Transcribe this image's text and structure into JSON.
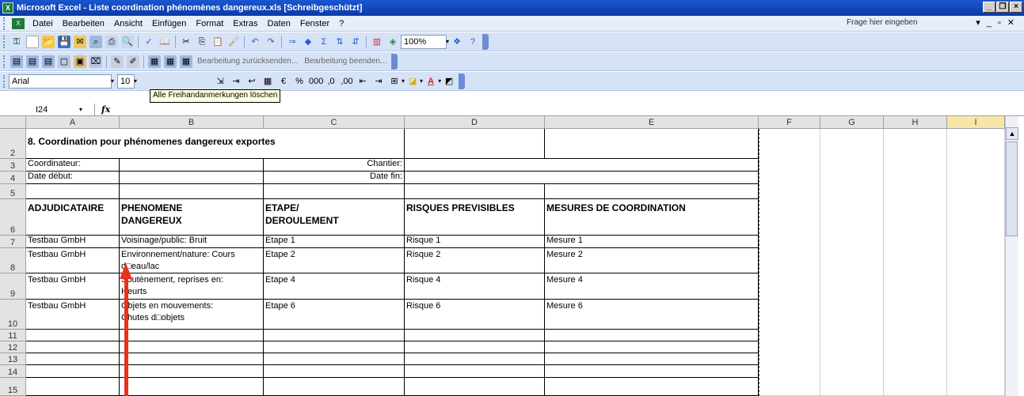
{
  "window": {
    "title": "Microsoft Excel - Liste coordination phénomènes dangereux.xls  [Schreibgeschützt]",
    "app_icon": "X"
  },
  "menu": {
    "items": [
      "Datei",
      "Bearbeiten",
      "Ansicht",
      "Einfügen",
      "Format",
      "Extras",
      "Daten",
      "Fenster",
      "?"
    ],
    "ask_placeholder": "Frage hier eingeben"
  },
  "toolbar": {
    "zoom": "100%",
    "review_undo": "Bearbeitung zurücksenden...",
    "review_end": "Bearbeitung beenden..."
  },
  "format": {
    "font": "Arial",
    "size": "10"
  },
  "tooltip": "Alle Freihandanmerkungen löschen",
  "formula_bar": {
    "cell_ref": "I24",
    "fx": "fx",
    "value": ""
  },
  "columns": [
    "A",
    "B",
    "C",
    "D",
    "E",
    "F",
    "G",
    "H",
    "I"
  ],
  "rows": [
    "2",
    "3",
    "4",
    "5",
    "6",
    "7",
    "8",
    "9",
    "10",
    "11",
    "12",
    "13",
    "14",
    "15"
  ],
  "cells": {
    "title": "8. Coordination pour phénomenes dangereux exportes",
    "coordinateur": "Coordinateur:",
    "chantier": "Chantier:",
    "date_debut": "Date début:",
    "date_fin": "Date fin:",
    "h_adjudicataire": "ADJUDICATAIRE",
    "h_phenomene_1": "PHENOMENE",
    "h_phenomene_2": "DANGEREUX",
    "h_etape_1": "ETAPE/",
    "h_etape_2": "DEROULEMENT",
    "h_risques": "RISQUES PREVISIBLES",
    "h_mesures": "MESURES DE COORDINATION",
    "r7": [
      "Testbau GmbH",
      "Voisinage/public: Bruit",
      "Etape 1",
      "Risque 1",
      "Mesure 1"
    ],
    "r8": [
      "Testbau GmbH",
      "Environnement/nature: Cours",
      "d□eau/lac",
      "Etape 2",
      "Risque 2",
      "Mesure 2"
    ],
    "r9": [
      "Testbau GmbH",
      "Soutènement, reprises en:",
      "Heurts",
      "Etape 4",
      "Risque 4",
      "Mesure 4"
    ],
    "r10": [
      "Testbau GmbH",
      "Objets en mouvements:",
      "Chutes d□objets",
      "Etape 6",
      "Risque 6",
      "Mesure 6"
    ]
  },
  "colors": {
    "title_bar": "#0a3aa8",
    "toolbar": "#d6e3f7",
    "tooltip": "#ffffe1",
    "arrow": "#e8321e"
  }
}
